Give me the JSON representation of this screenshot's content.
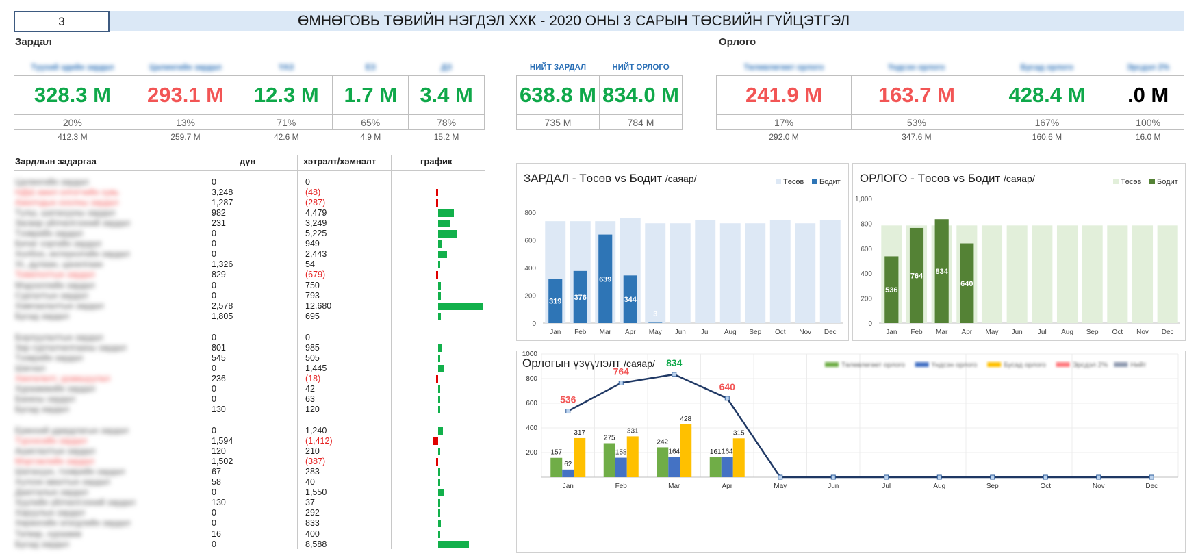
{
  "header": {
    "month": "3",
    "title": "ӨМНӨГОВЬ ТӨВИЙН НЭГДЭЛ ХХК - 2020 ОНЫ 3 САРЫН ТӨСВИЙН ГҮЙЦЭТГЭЛ"
  },
  "expense": {
    "section_label": "Зардал",
    "cards": [
      {
        "header": "Түүхий эдийн зардал",
        "value": "328.3 M",
        "pct": "20%",
        "base": "412.3 M",
        "status": "good"
      },
      {
        "header": "Цалингийн зардал",
        "value": "293.1 M",
        "pct": "13%",
        "base": "259.7 M",
        "status": "bad"
      },
      {
        "header": "ҮАЗ",
        "value": "12.3 M",
        "pct": "71%",
        "base": "42.6 M",
        "status": "good"
      },
      {
        "header": "ЕЗ",
        "value": "1.7 M",
        "pct": "65%",
        "base": "4.9 M",
        "status": "good"
      },
      {
        "header": "ДЗ",
        "value": "3.4 M",
        "pct": "78%",
        "base": "15.2 M",
        "status": "good"
      }
    ]
  },
  "totals": {
    "cards": [
      {
        "header": "НИЙТ ЗАРДАЛ",
        "value": "638.8 M",
        "base": "735 M"
      },
      {
        "header": "НИЙТ ОРЛОГО",
        "value": "834.0 M",
        "base": "784 M"
      }
    ]
  },
  "income": {
    "section_label": "Орлого",
    "cards": [
      {
        "header": "Төлөвлөгөөт орлого",
        "value": "241.9 M",
        "pct": "17%",
        "base": "292.0 M",
        "status": "bad"
      },
      {
        "header": "Үндсэн орлого",
        "value": "163.7 M",
        "pct": "53%",
        "base": "347.6 M",
        "status": "bad"
      },
      {
        "header": "Бусад орлого",
        "value": "428.4 M",
        "pct": "167%",
        "base": "160.6 M",
        "status": "good"
      },
      {
        "header": "Эрсдэл 2%",
        "value": ".0 M",
        "pct": "100%",
        "base": "16.0 M",
        "status": "neutral"
      }
    ]
  },
  "detail": {
    "headers": {
      "name": "Зардлын задаргаа",
      "amount": "дүн",
      "variance": "хэтрэлт/хэмнэлт",
      "chart": "график"
    },
    "groups": [
      {
        "rows": [
          {
            "name": "Цалингийн зардал",
            "amount": "0",
            "variance": "0",
            "neg": false,
            "bar": 0
          },
          {
            "name": "НДШ ажил олгогчийн хувь",
            "amount": "3,248",
            "variance": "(48)",
            "neg": true,
            "bar": -48
          },
          {
            "name": "Ажилчдын хоолны зардал",
            "amount": "1,287",
            "variance": "(287)",
            "neg": true,
            "bar": -287
          },
          {
            "name": "Түлш, шатахууны зардал",
            "amount": "982",
            "variance": "4,479",
            "neg": false,
            "bar": 4479
          },
          {
            "name": "Засвар үйлчилгээний зардал",
            "amount": "231",
            "variance": "3,249",
            "neg": false,
            "bar": 3249
          },
          {
            "name": "Тээврийн зардал",
            "amount": "0",
            "variance": "5,225",
            "neg": false,
            "bar": 5225
          },
          {
            "name": "Бичиг хэргийн зардал",
            "amount": "0",
            "variance": "949",
            "neg": false,
            "bar": 949
          },
          {
            "name": "Холбоо, интернэтийн зардал",
            "amount": "0",
            "variance": "2,443",
            "neg": false,
            "bar": 2443
          },
          {
            "name": "Ус, дулаан, цахилгаан",
            "amount": "1,326",
            "variance": "54",
            "neg": false,
            "bar": 54
          },
          {
            "name": "Томилолтын зардал",
            "amount": "829",
            "variance": "(679)",
            "neg": true,
            "bar": -679
          },
          {
            "name": "Мэдээллийн зардал",
            "amount": "0",
            "variance": "750",
            "neg": false,
            "bar": 750
          },
          {
            "name": "Сургалтын зардал",
            "amount": "0",
            "variance": "793",
            "neg": false,
            "bar": 793
          },
          {
            "name": "Хамгаалалтын зардал",
            "amount": "2,578",
            "variance": "12,680",
            "neg": false,
            "bar": 12680
          },
          {
            "name": "Бусад зардал",
            "amount": "1,805",
            "variance": "695",
            "neg": false,
            "bar": 695
          }
        ]
      },
      {
        "rows": [
          {
            "name": "Борлуулалтын зардал",
            "amount": "0",
            "variance": "0",
            "neg": false,
            "bar": 0
          },
          {
            "name": "Зар сурталчилгааны зардал",
            "amount": "801",
            "variance": "985",
            "neg": false,
            "bar": 985
          },
          {
            "name": "Тээврийн зардал",
            "amount": "545",
            "variance": "505",
            "neg": false,
            "bar": 505
          },
          {
            "name": "Шагнал",
            "amount": "0",
            "variance": "1,445",
            "neg": false,
            "bar": 1445
          },
          {
            "name": "Хөнгөлөлт, урамшуулал",
            "amount": "236",
            "variance": "(18)",
            "neg": true,
            "bar": -18
          },
          {
            "name": "Хураамжийн зардал",
            "amount": "0",
            "variance": "42",
            "neg": false,
            "bar": 42
          },
          {
            "name": "Банкны зардал",
            "amount": "0",
            "variance": "63",
            "neg": false,
            "bar": 63
          },
          {
            "name": "Бусад зардал",
            "amount": "130",
            "variance": "120",
            "neg": false,
            "bar": 120
          }
        ]
      },
      {
        "rows": [
          {
            "name": "Ерөнхий удирдлагын зардал",
            "amount": "0",
            "variance": "1,240",
            "neg": false,
            "bar": 1240
          },
          {
            "name": "Түрээсийн зардал",
            "amount": "1,594",
            "variance": "(1,412)",
            "neg": true,
            "bar": -1412
          },
          {
            "name": "Ашиглалтын зардал",
            "amount": "120",
            "variance": "210",
            "neg": false,
            "bar": 210
          },
          {
            "name": "Мэргэжлийн зардал",
            "amount": "1,502",
            "variance": "(387)",
            "neg": true,
            "bar": -387
          },
          {
            "name": "Шатахуун, тээврийн зардал",
            "amount": "67",
            "variance": "283",
            "neg": false,
            "bar": 283
          },
          {
            "name": "Хүлээн авалтын зардал",
            "amount": "58",
            "variance": "40",
            "neg": false,
            "bar": 40
          },
          {
            "name": "Даатгалын зардал",
            "amount": "0",
            "variance": "1,550",
            "neg": false,
            "bar": 1550
          },
          {
            "name": "Хуулийн үйлчилгээний зардал",
            "amount": "130",
            "variance": "37",
            "neg": false,
            "bar": 37
          },
          {
            "name": "Харуулын зардал",
            "amount": "0",
            "variance": "292",
            "neg": false,
            "bar": 292
          },
          {
            "name": "Хөрөнгийн элэгдлийн зардал",
            "amount": "0",
            "variance": "833",
            "neg": false,
            "bar": 833
          },
          {
            "name": "Татвар, хураамж",
            "amount": "16",
            "variance": "400",
            "neg": false,
            "bar": 400
          },
          {
            "name": "Бусад зардал",
            "amount": "0",
            "variance": "8,588",
            "neg": false,
            "bar": 8588
          }
        ]
      }
    ]
  },
  "chart_data": [
    {
      "type": "bar",
      "title": "ЗАРДАЛ - Төсөв vs Бодит",
      "unit": "/саяар/",
      "categories": [
        "Jan",
        "Feb",
        "Mar",
        "Apr",
        "May",
        "Jun",
        "Jul",
        "Aug",
        "Sep",
        "Oct",
        "Nov",
        "Dec"
      ],
      "series": [
        {
          "name": "Төсөв",
          "values": [
            735,
            735,
            735,
            760,
            720,
            720,
            745,
            720,
            720,
            745,
            720,
            745
          ],
          "color": "#dde8f5"
        },
        {
          "name": "Бодит",
          "values": [
            319,
            376,
            639,
            344,
            3,
            0,
            0,
            0,
            0,
            0,
            0,
            0
          ],
          "color": "#2e75b6"
        }
      ],
      "data_labels": [
        "319",
        "376",
        "639",
        "344",
        "3",
        "",
        "",
        "",
        "",
        "",
        "",
        ""
      ],
      "ylim": [
        0,
        800
      ],
      "yticks": [
        "0",
        "200",
        "400",
        "600",
        "800"
      ],
      "grid": false,
      "legend": "top-right"
    },
    {
      "type": "bar",
      "title": "ОРЛОГО - Төсөв vs Бодит",
      "unit": "/саяар/",
      "categories": [
        "Jan",
        "Feb",
        "Mar",
        "Apr",
        "May",
        "Jun",
        "Jul",
        "Aug",
        "Sep",
        "Oct",
        "Nov",
        "Dec"
      ],
      "series": [
        {
          "name": "Төсөв",
          "values": [
            784,
            784,
            784,
            784,
            784,
            784,
            784,
            784,
            784,
            784,
            784,
            784
          ],
          "color": "#e2efda"
        },
        {
          "name": "Бодит",
          "values": [
            536,
            764,
            834,
            640,
            0,
            0,
            0,
            0,
            0,
            0,
            0,
            0
          ],
          "color": "#548235"
        }
      ],
      "data_labels": [
        "536",
        "764",
        "834",
        "640",
        "",
        "",
        "",
        "",
        "",
        "",
        "",
        ""
      ],
      "ylim": [
        0,
        1000
      ],
      "yticks": [
        "0",
        "200",
        "400",
        "600",
        "800",
        "1,000"
      ],
      "grid": false,
      "legend": "top-right"
    },
    {
      "type": "bar",
      "title": "Орлогын үзүүлэлт",
      "unit": "/саяар/",
      "categories": [
        "Jan",
        "Feb",
        "Mar",
        "Apr",
        "May",
        "Jun",
        "Jul",
        "Aug",
        "Sep",
        "Oct",
        "Nov",
        "Dec"
      ],
      "series": [
        {
          "name": "Төлөвлөгөөт орлого",
          "values": [
            157,
            275,
            242,
            161,
            0,
            0,
            0,
            0,
            0,
            0,
            0,
            0
          ],
          "color": "#70ad47",
          "labels": [
            "157",
            "275",
            "242",
            "161",
            "",
            "",
            "",
            "",
            "",
            "",
            "",
            ""
          ]
        },
        {
          "name": "Үндсэн орлого",
          "values": [
            62,
            158,
            164,
            164,
            0,
            0,
            0,
            0,
            0,
            0,
            0,
            0
          ],
          "color": "#4472c4",
          "labels": [
            "62",
            "158",
            "164",
            "164",
            "",
            "",
            "",
            "",
            "",
            "",
            "",
            ""
          ]
        },
        {
          "name": "Бусад орлого",
          "values": [
            317,
            331,
            428,
            315,
            0,
            0,
            0,
            0,
            0,
            0,
            0,
            0
          ],
          "color": "#ffc000",
          "labels": [
            "317",
            "331",
            "428",
            "315",
            "",
            "",
            "",
            "",
            "",
            "",
            "",
            ""
          ]
        },
        {
          "name": "Эрсдэл 2%",
          "values": [
            0,
            0,
            0,
            0,
            0,
            0,
            0,
            0,
            0,
            0,
            0,
            0
          ],
          "color": "#ff7c80"
        },
        {
          "name": "Нийт",
          "type": "line",
          "values": [
            536,
            764,
            834,
            640,
            0,
            0,
            0,
            0,
            0,
            0,
            0,
            0
          ],
          "color": "#1f3864",
          "labels": [
            "536",
            "764",
            "834",
            "640",
            "",
            "",
            "",
            "",
            "",
            "",
            "",
            ""
          ],
          "label_colors": [
            "#f25555",
            "#f25555",
            "#0fa84a",
            "#f25555"
          ]
        }
      ],
      "ylim": [
        0,
        1000
      ],
      "yticks": [
        "200",
        "400",
        "600",
        "800",
        "1000"
      ],
      "grid": true,
      "legend": "top-right"
    }
  ]
}
